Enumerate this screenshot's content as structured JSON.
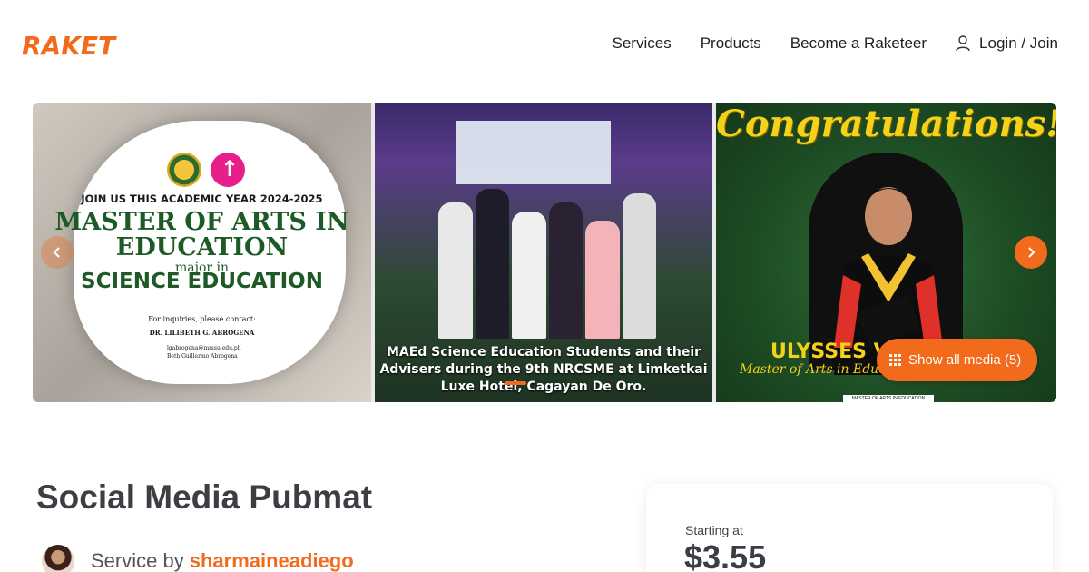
{
  "header": {
    "logo": "RAKET",
    "nav": {
      "services": "Services",
      "products": "Products",
      "become_raketeer": "Become a Raketeer",
      "login_join": "Login / Join"
    }
  },
  "gallery": {
    "tile1": {
      "line1": "JOIN US THIS ACADEMIC YEAR 2024-2025",
      "line2": "MASTER OF ARTS IN EDUCATION",
      "line3": "major in",
      "line4": "SCIENCE EDUCATION",
      "contact_heading": "For inquiries, please contact:",
      "contact_name": "DR. LILIBETH G. ABROGENA",
      "contact_email": "lgabrogena@mmsu.edu.ph",
      "contact_fb": "Beth Guillermo Abrogena"
    },
    "tile2": {
      "caption": "MAEd Science Education Students and their Advisers during the 9th NRCSME at Limketkai Luxe Hotel, Cagayan De Oro."
    },
    "tile3": {
      "heading": "Congratulations!",
      "name": "ULYSSES V.",
      "subtitle": "Master of Arts in Educ                    on)",
      "footer": "MASTER OF ARTS IN EDUCATION"
    },
    "show_all_label": "Show all media (5)"
  },
  "service": {
    "title": "Social Media Pubmat",
    "service_by_label": "Service by",
    "username": "sharmaineadiego"
  },
  "pricing": {
    "starting_label": "Starting at",
    "price": "$3.55"
  },
  "colors": {
    "accent": "#f26b1d",
    "title_text": "#3b3f44"
  }
}
